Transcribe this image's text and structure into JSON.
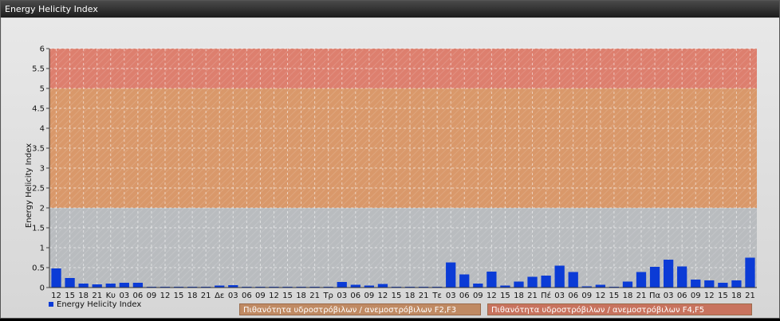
{
  "window": {
    "title": "Energy Helicity Index"
  },
  "colors": {
    "bar": "#0b3bd6",
    "band_low": "#b9bcbf",
    "band_mid": "#d9986a",
    "band_high": "#dd7f6e",
    "grid": "#ffffff"
  },
  "chart_data": {
    "type": "bar",
    "ylabel": "Energy Helicity Index",
    "ylim": [
      0,
      6
    ],
    "yticks": [
      "0",
      "0.5",
      "1",
      "1.5",
      "2",
      "2.5",
      "3",
      "3.5",
      "4",
      "4.5",
      "5",
      "5.5",
      "6"
    ],
    "grid": true,
    "bands": [
      {
        "from": 0,
        "to": 2,
        "color": "#b9bcbf"
      },
      {
        "from": 2,
        "to": 5,
        "color": "#d9986a"
      },
      {
        "from": 5,
        "to": 6,
        "color": "#dd7f6e"
      }
    ],
    "categories": [
      "12",
      "15",
      "18",
      "21",
      "Κυ",
      "03",
      "06",
      "09",
      "12",
      "15",
      "18",
      "21",
      "Δε",
      "03",
      "06",
      "09",
      "12",
      "15",
      "18",
      "21",
      "Τρ",
      "03",
      "06",
      "09",
      "12",
      "15",
      "18",
      "21",
      "Τε",
      "03",
      "06",
      "09",
      "12",
      "15",
      "18",
      "21",
      "Πέ",
      "03",
      "06",
      "09",
      "12",
      "15",
      "18",
      "21",
      "Πα",
      "03",
      "06",
      "09",
      "12",
      "15",
      "18",
      "21"
    ],
    "series": [
      {
        "name": "Energy Helicity Index",
        "values": [
          0.48,
          0.24,
          0.1,
          0.08,
          0.1,
          0.12,
          0.12,
          0.02,
          0.02,
          0.02,
          0.02,
          0.02,
          0.05,
          0.06,
          0.02,
          0.02,
          0.02,
          0.02,
          0.02,
          0.02,
          0.02,
          0.14,
          0.07,
          0.05,
          0.09,
          0.02,
          0.02,
          0.02,
          0.02,
          0.63,
          0.33,
          0.1,
          0.4,
          0.05,
          0.15,
          0.27,
          0.3,
          0.55,
          0.39,
          0.03,
          0.07,
          0.02,
          0.15,
          0.39,
          0.52,
          0.7,
          0.53,
          0.2,
          0.18,
          0.12,
          0.18,
          0.75
        ]
      }
    ],
    "legend_position": "bottom-left",
    "annotations": [
      "Πιθανότητα υδροστρόβιλων / ανεμοστρόβιλων F2,F3",
      "Πιθανότητα υδροστρόβιλων / ανεμοστρόβιλων F4,F5"
    ]
  }
}
